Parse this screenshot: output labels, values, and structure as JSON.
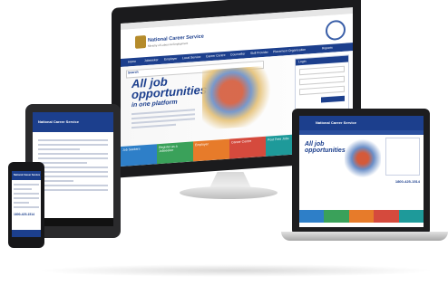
{
  "site": {
    "title": "National Career Service",
    "subtitle": "Ministry of Labour & Employment",
    "nav": [
      "Home",
      "Jobseeker",
      "Employer",
      "Local Service",
      "Career Centre",
      "Counsellor",
      "Skill Provider",
      "Placement Organisation",
      "Reports"
    ],
    "search_label": "Search",
    "hero_title": "All job opportunities",
    "hero_sub": "in one platform",
    "login_title": "Login",
    "login_button": "Sign In",
    "helpline_label": "Toll Free Helpline",
    "helpline_number": "1800-425-1514",
    "tiles": [
      {
        "label": "Job Seekers",
        "color": "#2e7fc8"
      },
      {
        "label": "Register as a Jobseeker",
        "color": "#3aa15a"
      },
      {
        "label": "Employer",
        "color": "#e77b2a"
      },
      {
        "label": "Career Centre",
        "color": "#d54a3d"
      },
      {
        "label": "Post Free Jobs",
        "color": "#1e9a9a"
      },
      {
        "label": "Skill Provider",
        "color": "#1c3f8d"
      }
    ]
  },
  "laptop": {
    "title": "National Career Service",
    "hero_title": "All job opportunities",
    "helpline_number": "1800-425-1514"
  },
  "tablet": {
    "title": "National Career Service"
  },
  "phone": {
    "title": "National Career Service",
    "helpline_number": "1800-425-1514"
  }
}
